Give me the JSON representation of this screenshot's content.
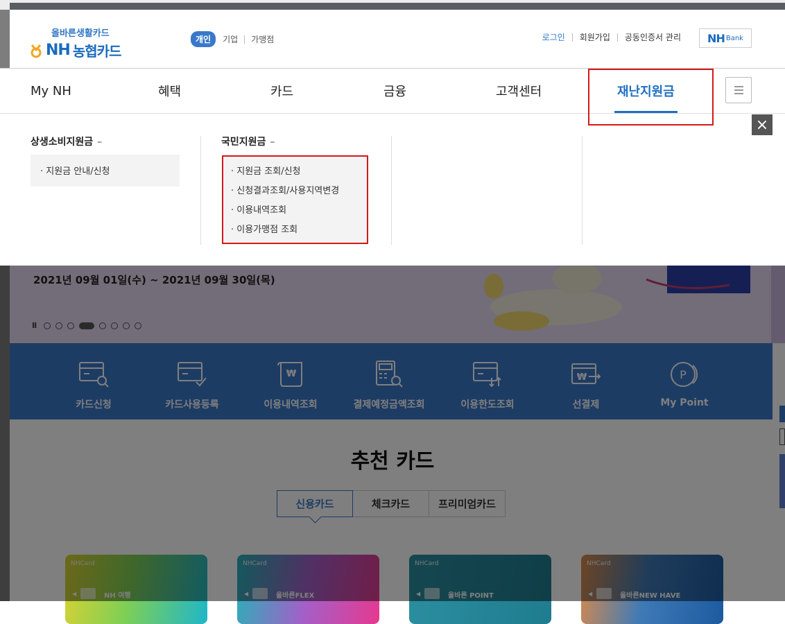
{
  "header": {
    "logo_sub": "올바른생활카드",
    "logo_nh": "NH",
    "logo_kr": "농협카드",
    "segments": [
      {
        "label": "개인",
        "active": true
      },
      {
        "label": "기업",
        "active": false
      },
      {
        "label": "가맹점",
        "active": false
      }
    ],
    "util": [
      "로그인",
      "회원가입",
      "공동인증서 관리"
    ],
    "nhbank_nh": "NH",
    "nhbank_bank": "Bank"
  },
  "gnb": {
    "items": [
      "My NH",
      "혜택",
      "카드",
      "금융",
      "고객센터",
      "재난지원금"
    ],
    "active_index": 5
  },
  "mega": {
    "col1": {
      "title": "상생소비지원금",
      "dash": "–",
      "items": [
        "지원금 안내/신청"
      ]
    },
    "col2": {
      "title": "국민지원금",
      "dash": "–",
      "items": [
        "지원금 조회/신청",
        "신청결과조회/사용지역변경",
        "이용내역조회",
        "이용가맹점 조회"
      ]
    },
    "close_label": "×"
  },
  "banner": {
    "date": "2021년 09월 01일(수) ~ 2021년 09월 30일(목)",
    "pause": "II",
    "slide_count": 8,
    "active_slide": 3
  },
  "quick_menu": [
    {
      "label": "카드신청",
      "icon": "card-search-icon"
    },
    {
      "label": "카드사용등록",
      "icon": "card-check-icon"
    },
    {
      "label": "이용내역조회",
      "icon": "receipt-won-icon"
    },
    {
      "label": "결제예정금액조회",
      "icon": "calculator-search-icon"
    },
    {
      "label": "이용한도조회",
      "icon": "card-limit-icon"
    },
    {
      "label": "선결제",
      "icon": "card-won-arrow-icon"
    },
    {
      "label": "My Point",
      "icon": "point-coin-icon"
    }
  ],
  "recommend": {
    "title": "추천 카드",
    "tabs": [
      "신용카드",
      "체크카드",
      "프리미엄카드"
    ],
    "active_tab": 0,
    "cards": [
      {
        "brand": "NHCard",
        "name": "NH 여행"
      },
      {
        "brand": "NHCard",
        "name": "올바른FLEX"
      },
      {
        "brand": "NHCard",
        "name": "올바른 POINT"
      },
      {
        "brand": "NHCard",
        "name": "올바른NEW HAVE"
      }
    ]
  },
  "colors": {
    "brand_blue": "#3a78c9",
    "highlight_red": "#d51818",
    "banner_bg": "#e6d9f2"
  }
}
